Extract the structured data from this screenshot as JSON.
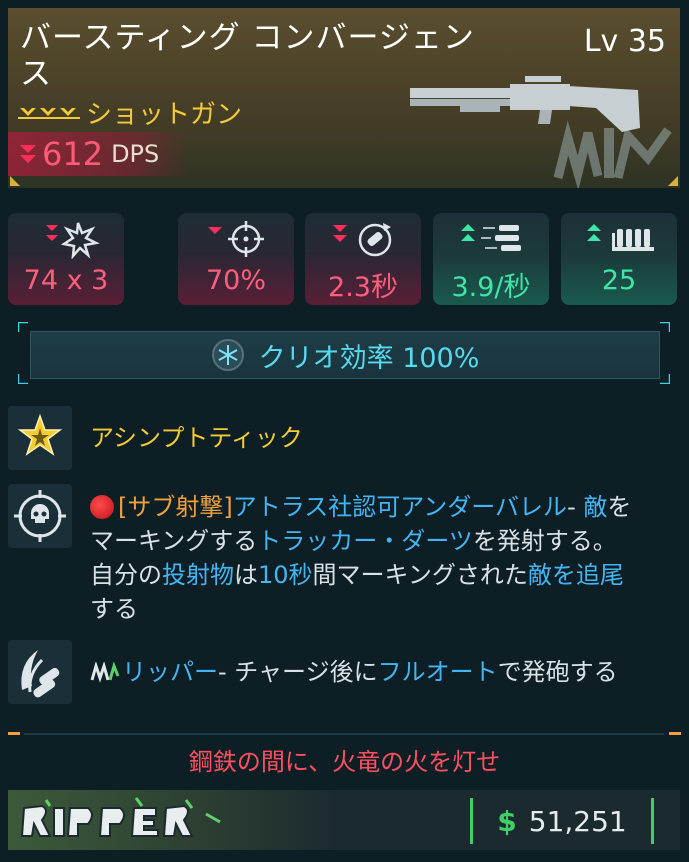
{
  "weapon": {
    "name": "バースティング コンバージェンス",
    "level": "Lv 35",
    "type": "ショットガン",
    "dps": "612",
    "dps_unit": "DPS"
  },
  "stats": [
    {
      "icon": "damage-burst-icon",
      "value": "74 x 3",
      "trend": "down-2",
      "color": "#ff5f7e"
    },
    {
      "icon": "crosshair-icon",
      "value": "70%",
      "trend": "down-1",
      "color": "#ff5f7e"
    },
    {
      "icon": "reload-icon",
      "value": "2.3秒",
      "trend": "down-2",
      "color": "#ff5f7e"
    },
    {
      "icon": "fire-rate-icon",
      "value": "3.9/秒",
      "trend": "up-2",
      "color": "#3fe6a8"
    },
    {
      "icon": "magazine-icon",
      "value": "25",
      "trend": "up-2",
      "color": "#3fe6a8"
    }
  ],
  "cryo": {
    "label": "クリオ効率 100%"
  },
  "perks": [
    {
      "icon": "star-badge-icon",
      "title": "アシンプトティック"
    },
    {
      "icon": "skull-target-icon",
      "segments": [
        {
          "text": "[サブ射撃]",
          "style": "orange"
        },
        {
          "text": "アトラス社認可アンダーバレル",
          "style": "blue"
        },
        {
          "text": "- ",
          "style": "plain"
        },
        {
          "text": "敵",
          "style": "blue"
        },
        {
          "text": "を",
          "style": "plain"
        },
        {
          "text": "マーキングする",
          "style": "plain"
        },
        {
          "text": "トラッカー・ダーツ",
          "style": "blue"
        },
        {
          "text": "を発射する。",
          "style": "plain"
        },
        {
          "text": "自分の",
          "style": "plain"
        },
        {
          "text": "投射物",
          "style": "blue"
        },
        {
          "text": "は",
          "style": "plain"
        },
        {
          "text": "10秒",
          "style": "blue"
        },
        {
          "text": "間マーキングされた",
          "style": "plain"
        },
        {
          "text": "敵を追尾",
          "style": "blue"
        },
        {
          "text": "する",
          "style": "plain"
        }
      ]
    },
    {
      "icon": "blade-bullet-icon",
      "segments": [
        {
          "text": "リッパー",
          "style": "blue"
        },
        {
          "text": "- チャージ後に",
          "style": "plain"
        },
        {
          "text": "フルオート",
          "style": "blue"
        },
        {
          "text": "で発砲する",
          "style": "plain"
        }
      ]
    }
  ],
  "flavor": "鋼鉄の間に、火竜の火を灯せ",
  "footer": {
    "brand": "RIPPER",
    "currency_symbol": "$",
    "price": "51,251"
  },
  "colors": {
    "accent_teal": "#3fd0e6",
    "down_red": "#ff5f7e",
    "up_green": "#3fe6a8",
    "legendary_gold": "#f3cc35",
    "price_green": "#3fcf67"
  }
}
